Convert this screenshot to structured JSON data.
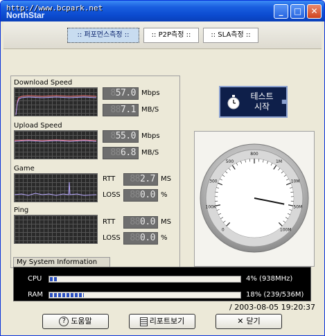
{
  "window": {
    "title_url": "http://www.bcpark.net",
    "title_logo": "NorthStar"
  },
  "tabs": [
    {
      "label": ":: 퍼포먼스측정 ::",
      "active": true
    },
    {
      "label": ":: P2P측정 ::",
      "active": false
    },
    {
      "label": ":: SLA측정 ::",
      "active": false
    }
  ],
  "download": {
    "label": "Download Speed",
    "rate_value": "57.0",
    "rate_unit": "Mbps",
    "bytes_value": "7.1",
    "bytes_unit": "MB/S"
  },
  "upload": {
    "label": "Upload Speed",
    "rate_value": "55.0",
    "rate_unit": "Mbps",
    "bytes_value": "6.8",
    "bytes_unit": "MB/S"
  },
  "game": {
    "label": "Game",
    "rtt_label": "RTT",
    "rtt_value": "2.7",
    "rtt_unit": "MS",
    "loss_label": "LOSS",
    "loss_value": "0.0",
    "loss_unit": "%"
  },
  "ping": {
    "label": "Ping",
    "rtt_label": "RTT",
    "rtt_value": "0.0",
    "rtt_unit": "MS",
    "loss_label": "LOSS",
    "loss_value": "0.0",
    "loss_unit": "%"
  },
  "start_button": {
    "label": "테스트\n시작"
  },
  "gauge": {
    "ticks": [
      "0",
      "100K",
      "300",
      "500",
      "800",
      "1M",
      "10M",
      "50M",
      "100M"
    ],
    "needle_value_label": "50M"
  },
  "system_info": {
    "title": "My System Information",
    "cpu": {
      "label": "CPU",
      "value": "4% (938MHz)",
      "fraction": 0.04
    },
    "ram": {
      "label": "RAM",
      "value": "18% (239/536M)",
      "fraction": 0.18
    }
  },
  "buttons": {
    "help": "도움말",
    "report": "리포트보기",
    "close": "닫기"
  },
  "timestamp": "/ 2003-08-05 19:20:37",
  "colors": {
    "titlebar": "#0b4bd0",
    "graph_line": "#b8a8ff",
    "graph_line_red": "#e86a6a",
    "lcd_bg": "#6e6e6e",
    "start_bg": "#0e1f4a",
    "bar_fill": "#2a4fc0"
  }
}
